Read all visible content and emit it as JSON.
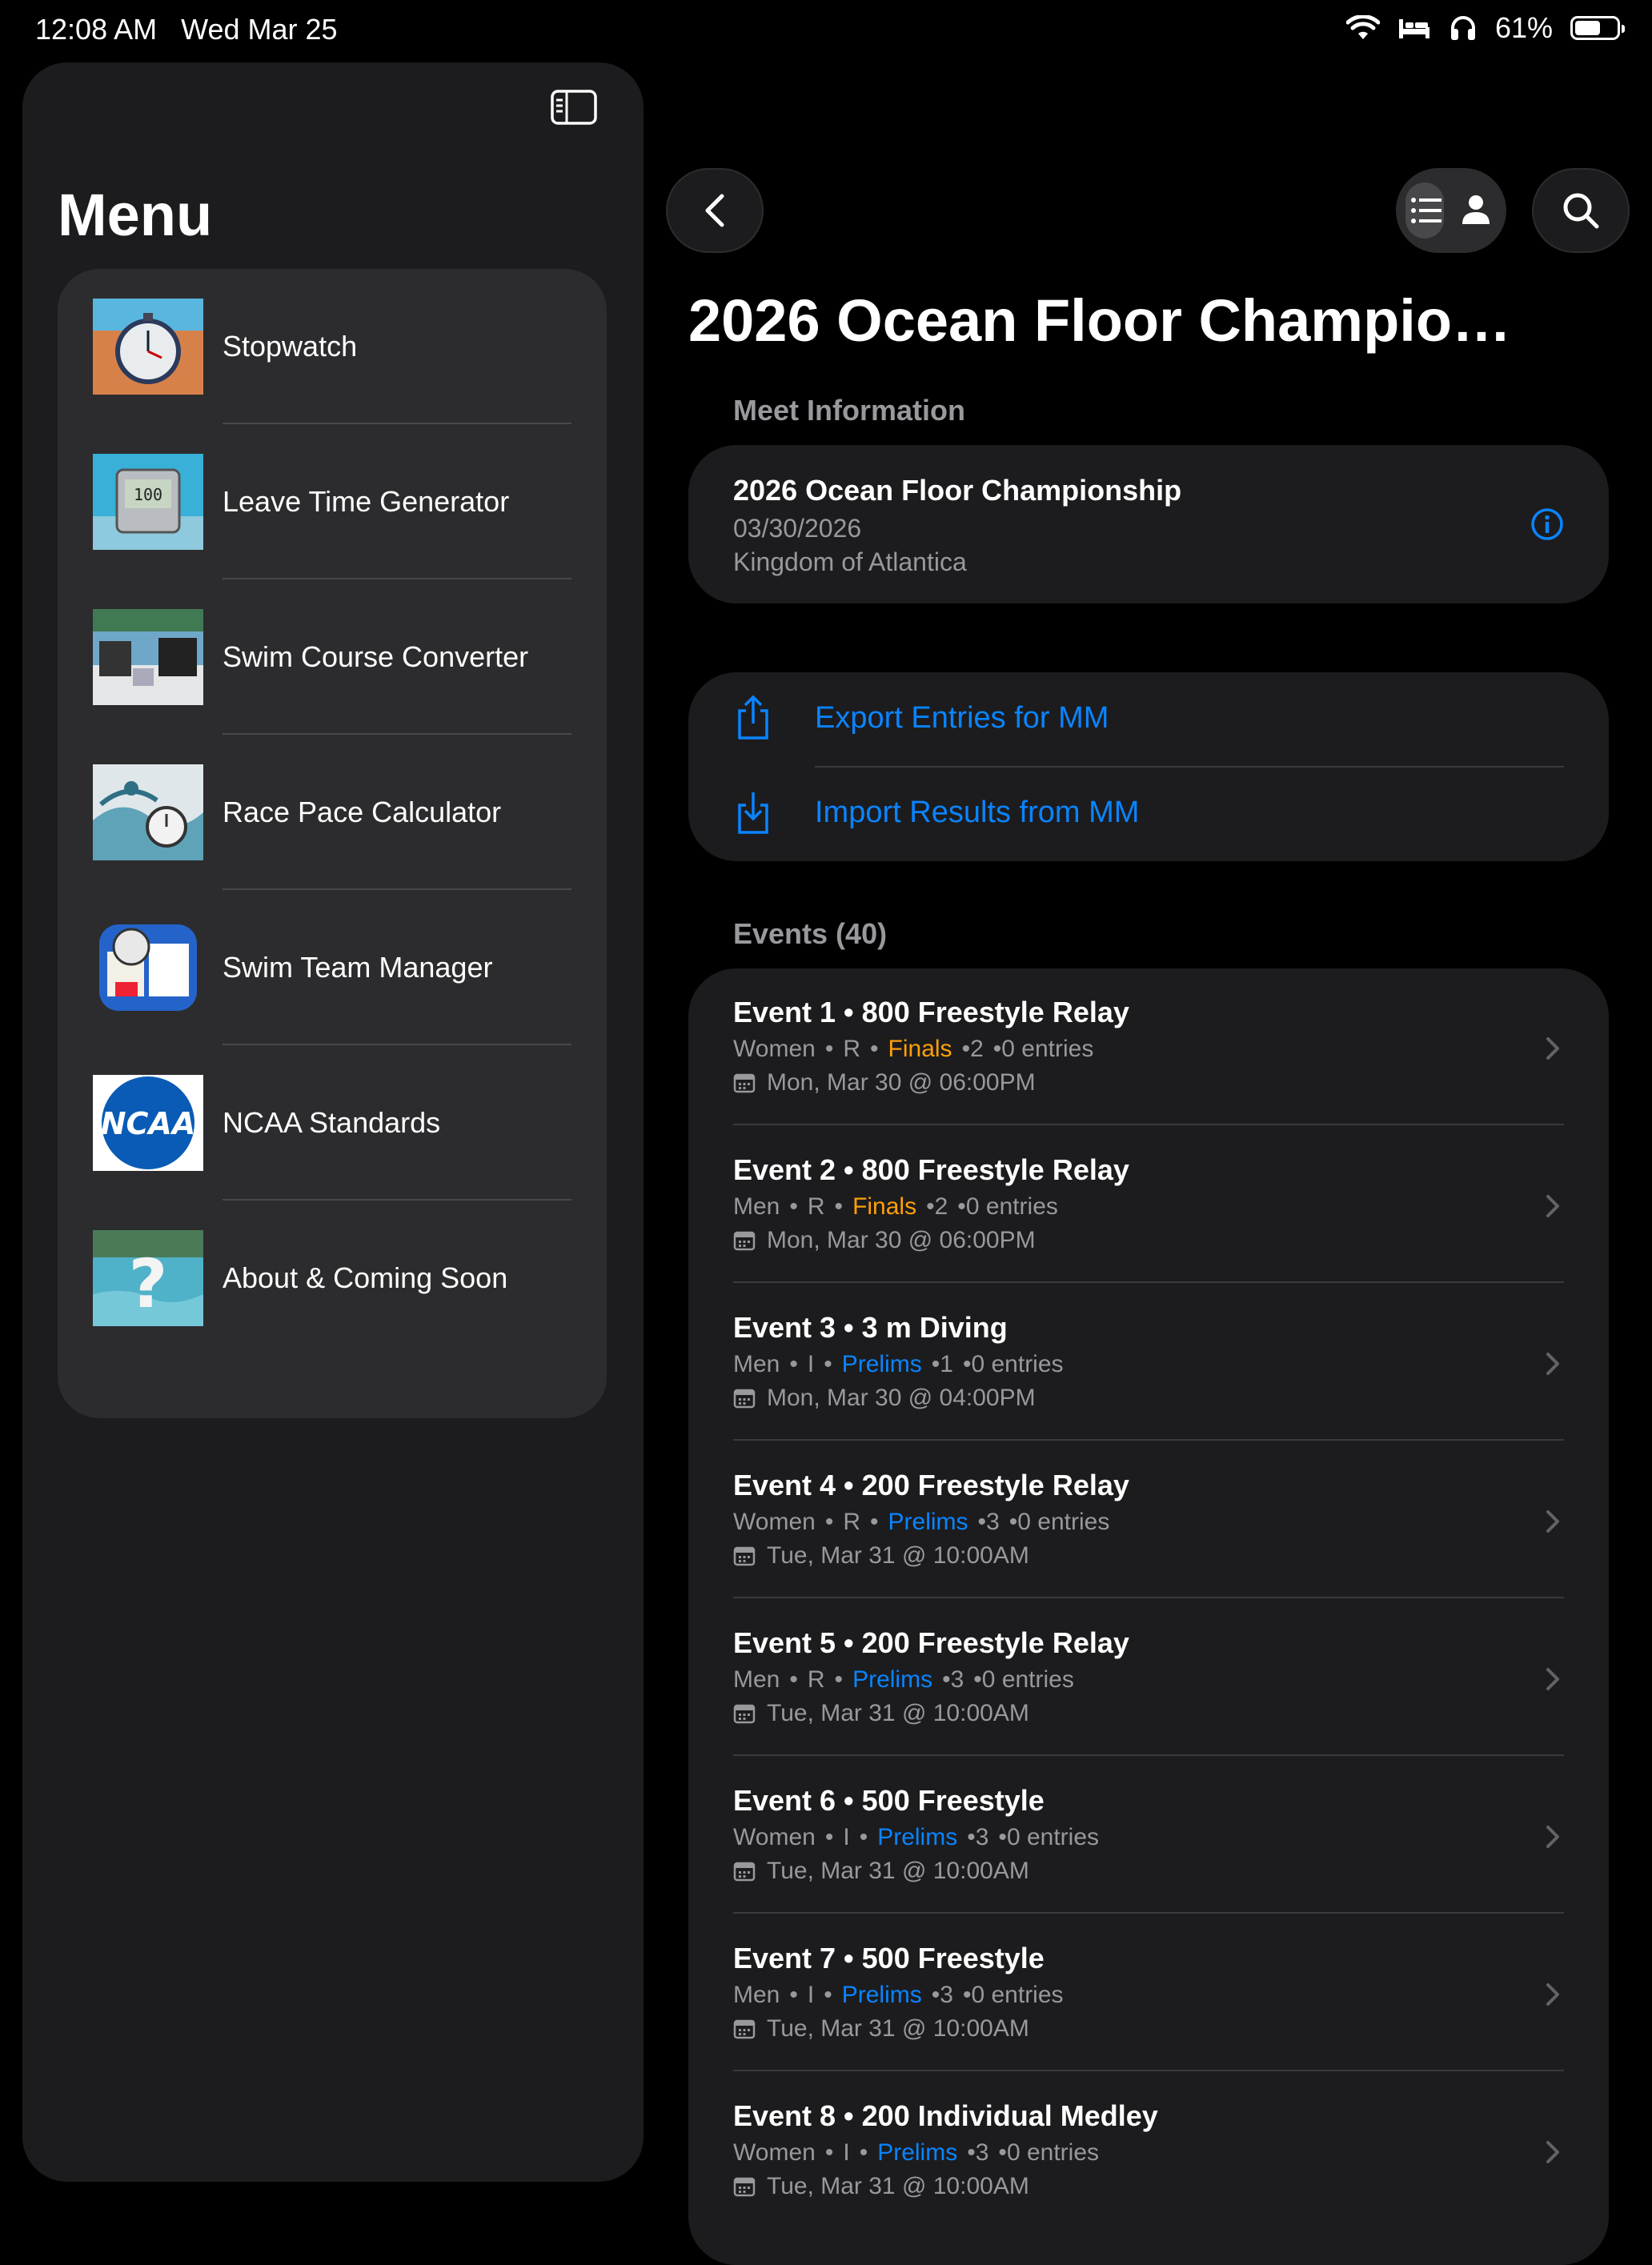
{
  "status": {
    "time": "12:08 AM",
    "date": "Wed Mar 25",
    "battery": "61%",
    "battery_level": 0.61
  },
  "sidebar": {
    "title": "Menu",
    "items": [
      {
        "label": "Stopwatch",
        "thumb": "stopwatch"
      },
      {
        "label": "Leave Time Generator",
        "thumb": "leave-time"
      },
      {
        "label": "Swim Course Converter",
        "thumb": "course-converter"
      },
      {
        "label": "Race Pace Calculator",
        "thumb": "race-pace"
      },
      {
        "label": "Swim Team Manager",
        "thumb": "team-manager"
      },
      {
        "label": "NCAA Standards",
        "thumb": "ncaa",
        "logo_text": "NCAA"
      },
      {
        "label": "About & Coming Soon",
        "thumb": "about"
      }
    ]
  },
  "page": {
    "title": "2026 Ocean Floor Champio…"
  },
  "meet": {
    "section_label": "Meet Information",
    "name": "2026 Ocean Floor Championship",
    "date": "03/30/2026",
    "location": "Kingdom of Atlantica"
  },
  "actions": [
    {
      "label": "Export Entries for MM",
      "icon": "share-icon"
    },
    {
      "label": "Import Results from MM",
      "icon": "download-icon"
    }
  ],
  "events_header": "Events (40)",
  "events": [
    {
      "title": "Event 1 • 800 Freestyle Relay",
      "gender": "Women",
      "type": "R",
      "round": "Finals",
      "heats": "2",
      "entries": "0 entries",
      "datetime": "Mon, Mar 30 @ 06:00PM"
    },
    {
      "title": "Event 2 • 800 Freestyle Relay",
      "gender": "Men",
      "type": "R",
      "round": "Finals",
      "heats": "2",
      "entries": "0 entries",
      "datetime": "Mon, Mar 30 @ 06:00PM"
    },
    {
      "title": "Event 3 • 3 m Diving",
      "gender": "Men",
      "type": "I",
      "round": "Prelims",
      "heats": "1",
      "entries": "0 entries",
      "datetime": "Mon, Mar 30 @ 04:00PM"
    },
    {
      "title": "Event 4 • 200 Freestyle Relay",
      "gender": "Women",
      "type": "R",
      "round": "Prelims",
      "heats": "3",
      "entries": "0 entries",
      "datetime": "Tue, Mar 31 @ 10:00AM"
    },
    {
      "title": "Event 5 • 200 Freestyle Relay",
      "gender": "Men",
      "type": "R",
      "round": "Prelims",
      "heats": "3",
      "entries": "0 entries",
      "datetime": "Tue, Mar 31 @ 10:00AM"
    },
    {
      "title": "Event 6 • 500 Freestyle",
      "gender": "Women",
      "type": "I",
      "round": "Prelims",
      "heats": "3",
      "entries": "0 entries",
      "datetime": "Tue, Mar 31 @ 10:00AM"
    },
    {
      "title": "Event 7 • 500 Freestyle",
      "gender": "Men",
      "type": "I",
      "round": "Prelims",
      "heats": "3",
      "entries": "0 entries",
      "datetime": "Tue, Mar 31 @ 10:00AM"
    },
    {
      "title": "Event 8 • 200 Individual Medley",
      "gender": "Women",
      "type": "I",
      "round": "Prelims",
      "heats": "3",
      "entries": "0 entries",
      "datetime": "Tue, Mar 31 @ 10:00AM"
    }
  ],
  "colors": {
    "accent": "#0a84ff",
    "finals": "#ff9f0a",
    "secondary_text": "#98989d",
    "card": "#1c1c1e"
  }
}
